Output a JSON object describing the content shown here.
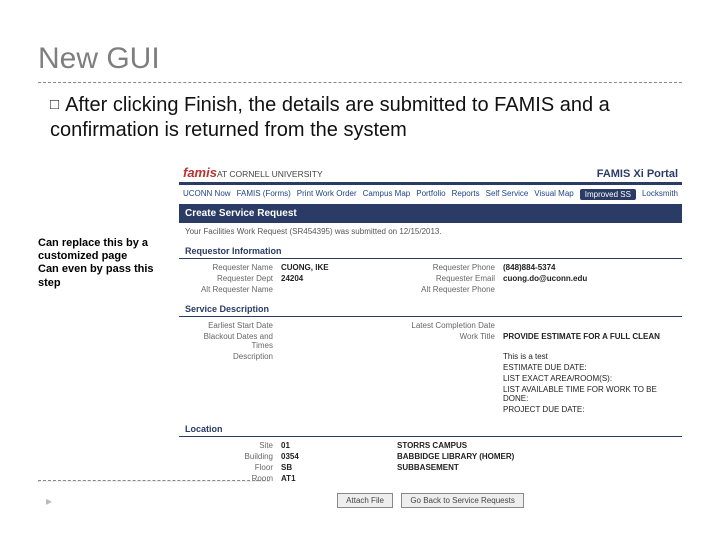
{
  "title": "New GUI",
  "bullet_prefix": "After",
  "bullet_rest": " clicking Finish, the details are submitted to FAMIS and a confirmation is returned from the system",
  "note_line1": "Can replace this by a customized page",
  "note_line2": "Can even by pass this step",
  "famis": {
    "brand": "famis",
    "brand_sub": "AT CORNELL UNIVERSITY",
    "portal": "FAMIS Xi Portal",
    "tabs": [
      "UCONN Now",
      "FAMIS (Forms)",
      "Print Work Order",
      "Campus Map",
      "Portfolio",
      "Reports",
      "Self Service",
      "Visual Map"
    ],
    "tab_active": "Improved SS",
    "tab_last": "Locksmith",
    "bar": "Create Service Request",
    "msg": "Your Facilities Work Request (SR454395) was submitted on 12/15/2013.",
    "sect_req": "Requestor Information",
    "req": {
      "name_lbl": "Requester Name",
      "name_val": "CUONG, IKE",
      "phone_lbl": "Requester Phone",
      "phone_val": "(848)884-5374",
      "dept_lbl": "Requester Dept",
      "dept_val": "24204",
      "email_lbl": "Requester Email",
      "email_val": "cuong.do@uconn.edu",
      "altname_lbl": "Alt Requester Name",
      "altname_val": "",
      "altphone_lbl": "Alt Requester Phone",
      "altphone_val": ""
    },
    "sect_svc": "Service Description",
    "svc": {
      "start_lbl": "Earliest Start Date",
      "start_val": "",
      "comp_lbl": "Latest Completion Date",
      "comp_val": "",
      "black_lbl": "Blackout Dates and Times",
      "black_val": "",
      "title_lbl": "Work Title",
      "title_val": "PROVIDE ESTIMATE FOR A FULL CLEAN",
      "desc_lbl": "Description",
      "desc_l1": "This is a test",
      "desc_l2": "ESTIMATE DUE DATE:",
      "desc_l3": "LIST EXACT AREA/ROOM(S):",
      "desc_l4": "LIST AVAILABLE TIME FOR WORK TO BE DONE:",
      "desc_l5": "PROJECT DUE DATE:"
    },
    "sect_loc": "Location",
    "loc": {
      "site_lbl": "Site",
      "site_val": "01",
      "site_desc": "STORRS CAMPUS",
      "bldg_lbl": "Building",
      "bldg_val": "0354",
      "bldg_desc": "BABBIDGE LIBRARY (HOMER)",
      "floor_lbl": "Floor",
      "floor_val": "SB",
      "floor_desc": "SUBBASEMENT",
      "room_lbl": "Room",
      "room_val": "AT1",
      "room_desc": ""
    },
    "btn_attach": "Attach File",
    "btn_back": "Go Back to Service Requests"
  }
}
